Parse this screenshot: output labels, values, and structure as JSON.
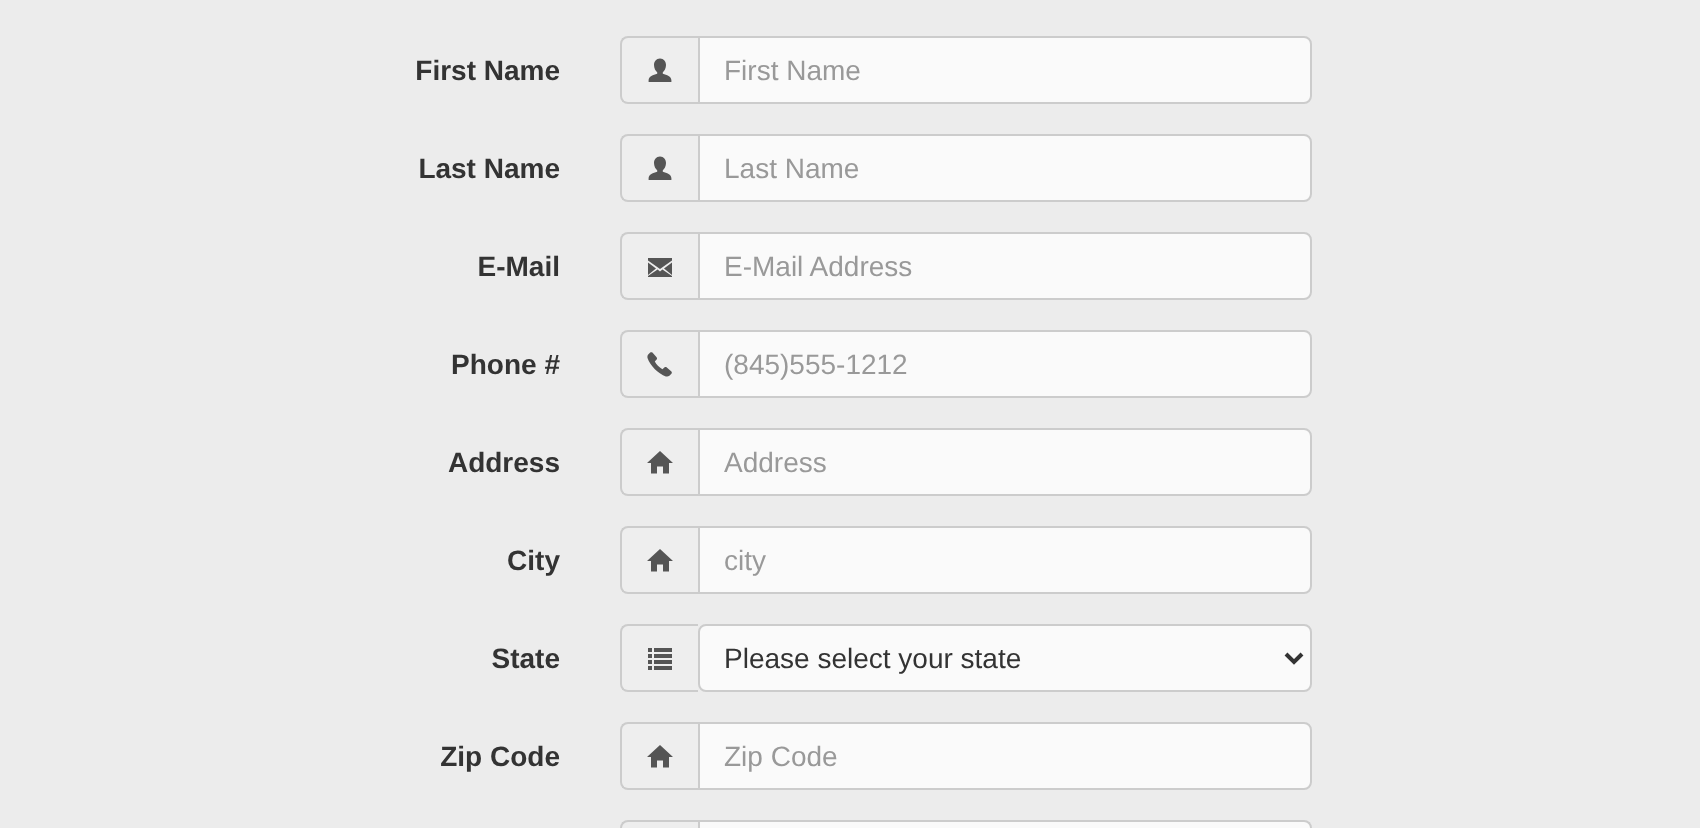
{
  "form": {
    "rows": [
      {
        "kind": "input",
        "label": "First Name",
        "placeholder": "First Name"
      },
      {
        "kind": "input",
        "label": "Last Name",
        "placeholder": "Last Name"
      },
      {
        "kind": "input",
        "label": "E-Mail",
        "placeholder": "E-Mail Address"
      },
      {
        "kind": "input",
        "label": "Phone #",
        "placeholder": "(845)555-1212"
      },
      {
        "kind": "input",
        "label": "Address",
        "placeholder": "Address"
      },
      {
        "kind": "input",
        "label": "City",
        "placeholder": "city"
      },
      {
        "kind": "select",
        "label": "State",
        "value": "Please select your state"
      },
      {
        "kind": "input",
        "label": "Zip Code",
        "placeholder": "Zip Code"
      },
      {
        "kind": "cut"
      }
    ]
  }
}
